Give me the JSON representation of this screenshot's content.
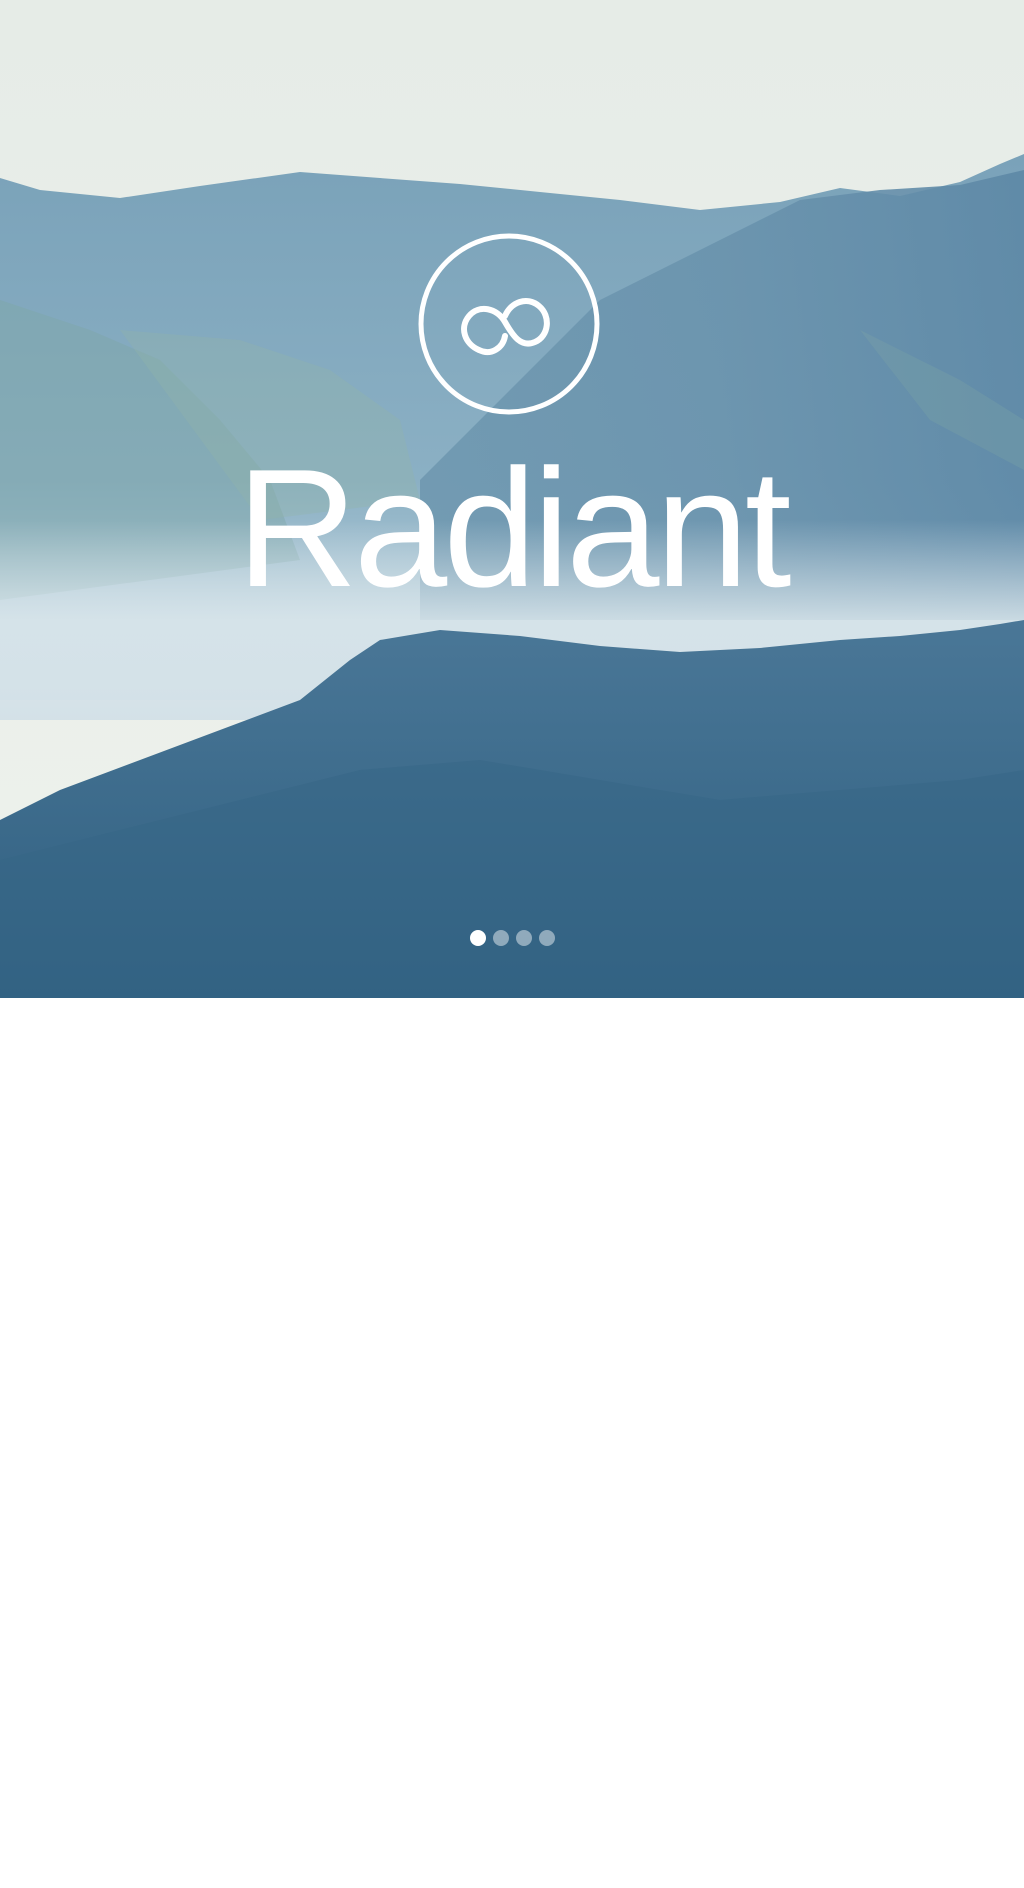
{
  "brand": {
    "name": "Radiant",
    "logo_icon": "infinity-loop-circle-icon"
  },
  "pager": {
    "total": 4,
    "active_index": 0
  },
  "colors": {
    "sky": "#e9efea",
    "far_mountain": "#6e98b3",
    "mid_mountain": "#5e8aa8",
    "near_mountain": "#3f6c8c",
    "text": "#ffffff"
  }
}
